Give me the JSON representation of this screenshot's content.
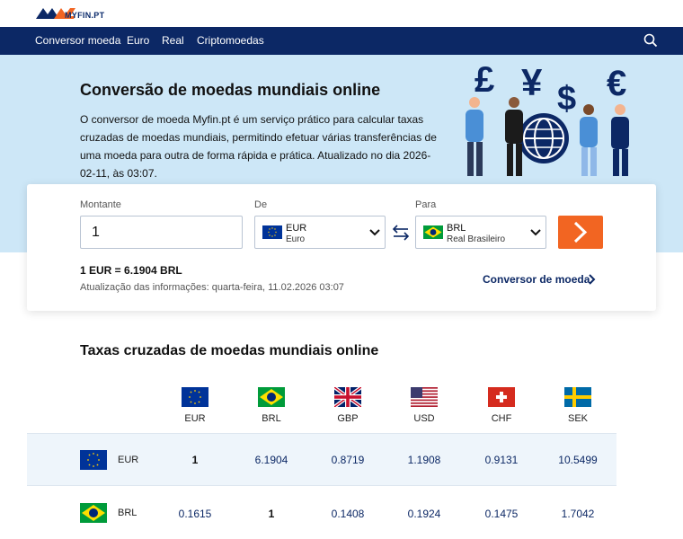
{
  "logo": {
    "text": "MYFIN.PT"
  },
  "nav": {
    "items": [
      "Conversor moeda",
      "Euro",
      "Real",
      "Criptomoedas"
    ]
  },
  "hero": {
    "title": "Conversão de moedas mundiais online",
    "text": "O conversor de moeda Myfin.pt é um serviço prático para calcular taxas cruzadas de moedas mundiais, permitindo efetuar várias transferências de uma moeda para outra de forma rápida e prática. Atualizado no dia 2026-02-11, às 03:07."
  },
  "converter": {
    "amount_label": "Montante",
    "amount_value": "1",
    "from_label": "De",
    "from_code": "EUR",
    "from_name": "Euro",
    "to_label": "Para",
    "to_code": "BRL",
    "to_name": "Real Brasileiro",
    "rate_text": "1 EUR = 6.1904 BRL",
    "updated_text": "Atualização das informações: quarta-feira, 11.02.2026 03:07",
    "link_label": "Conversor de moeda"
  },
  "table": {
    "title": "Taxas cruzadas de moedas mundiais online",
    "columns": [
      "EUR",
      "BRL",
      "GBP",
      "USD",
      "CHF",
      "SEK"
    ],
    "rows": [
      {
        "code": "EUR",
        "values": [
          "1",
          "6.1904",
          "0.8719",
          "1.1908",
          "0.9131",
          "10.5499"
        ]
      },
      {
        "code": "BRL",
        "values": [
          "0.1615",
          "1",
          "0.1408",
          "0.1924",
          "0.1475",
          "1.7042"
        ]
      }
    ]
  },
  "colors": {
    "nav_bg": "#0c2865",
    "hero_bg": "#cde7f7",
    "accent": "#f26522",
    "row_highlight": "#eef5fb"
  }
}
